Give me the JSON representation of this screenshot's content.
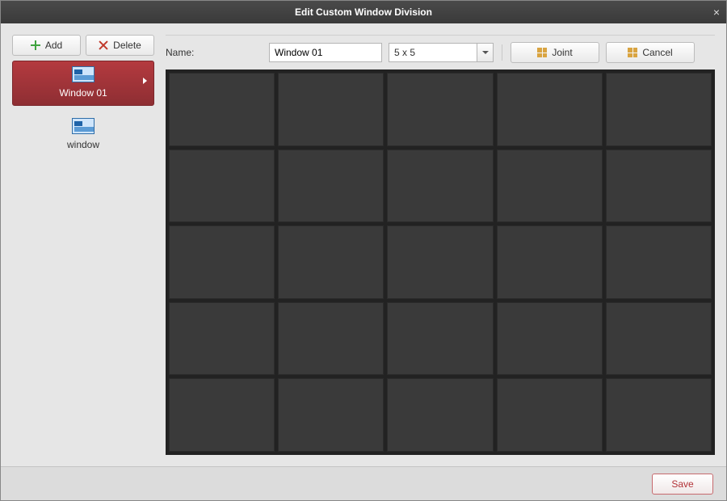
{
  "title": "Edit Custom Window Division",
  "sidebar": {
    "add_label": "Add",
    "delete_label": "Delete",
    "items": [
      {
        "label": "Window 01",
        "selected": true
      },
      {
        "label": "window",
        "selected": false
      }
    ]
  },
  "toolbar": {
    "name_label": "Name:",
    "name_value": "Window 01",
    "grid_select_value": "5 x 5",
    "joint_label": "Joint",
    "cancel_label": "Cancel"
  },
  "grid": {
    "rows": 5,
    "cols": 5
  },
  "footer": {
    "save_label": "Save"
  }
}
